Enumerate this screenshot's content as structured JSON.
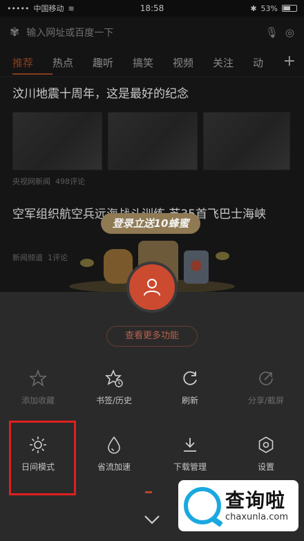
{
  "status": {
    "carrier": "中国移动",
    "time": "18:58",
    "battery": "53%"
  },
  "search": {
    "placeholder": "输入网址或百度一下"
  },
  "tabs": [
    "推荐",
    "热点",
    "趣听",
    "搞笑",
    "视频",
    "关注",
    "动"
  ],
  "feed": {
    "article1": {
      "title": "汶川地震十周年，这是最好的纪念",
      "source": "央视网新闻",
      "comments": "498评论"
    },
    "article2": {
      "title": "空军组织航空兵远海战斗训练 苏35首飞巴士海峡",
      "source": "新闻频道",
      "comments": "1评论"
    }
  },
  "promo": {
    "banner": "登录立送10蜂蜜"
  },
  "panel": {
    "more_button": "查看更多功能",
    "row1": [
      {
        "label": "添加收藏",
        "icon": "star-icon",
        "enabled": false
      },
      {
        "label": "书签/历史",
        "icon": "bookmark-history-icon",
        "enabled": true
      },
      {
        "label": "刷新",
        "icon": "refresh-icon",
        "enabled": true
      },
      {
        "label": "分享/截屏",
        "icon": "share-icon",
        "enabled": false
      }
    ],
    "row2": [
      {
        "label": "日间模式",
        "icon": "sun-icon",
        "enabled": true
      },
      {
        "label": "省流加速",
        "icon": "drop-icon",
        "enabled": true
      },
      {
        "label": "下载管理",
        "icon": "download-icon",
        "enabled": true
      },
      {
        "label": "设置",
        "icon": "settings-icon",
        "enabled": true
      }
    ]
  },
  "watermark": {
    "name": "查询啦",
    "url": "chaxunla.com"
  },
  "colors": {
    "accent": "#cc4a30",
    "highlight": "#e02020",
    "watermark_blue": "#1aa8e0"
  }
}
